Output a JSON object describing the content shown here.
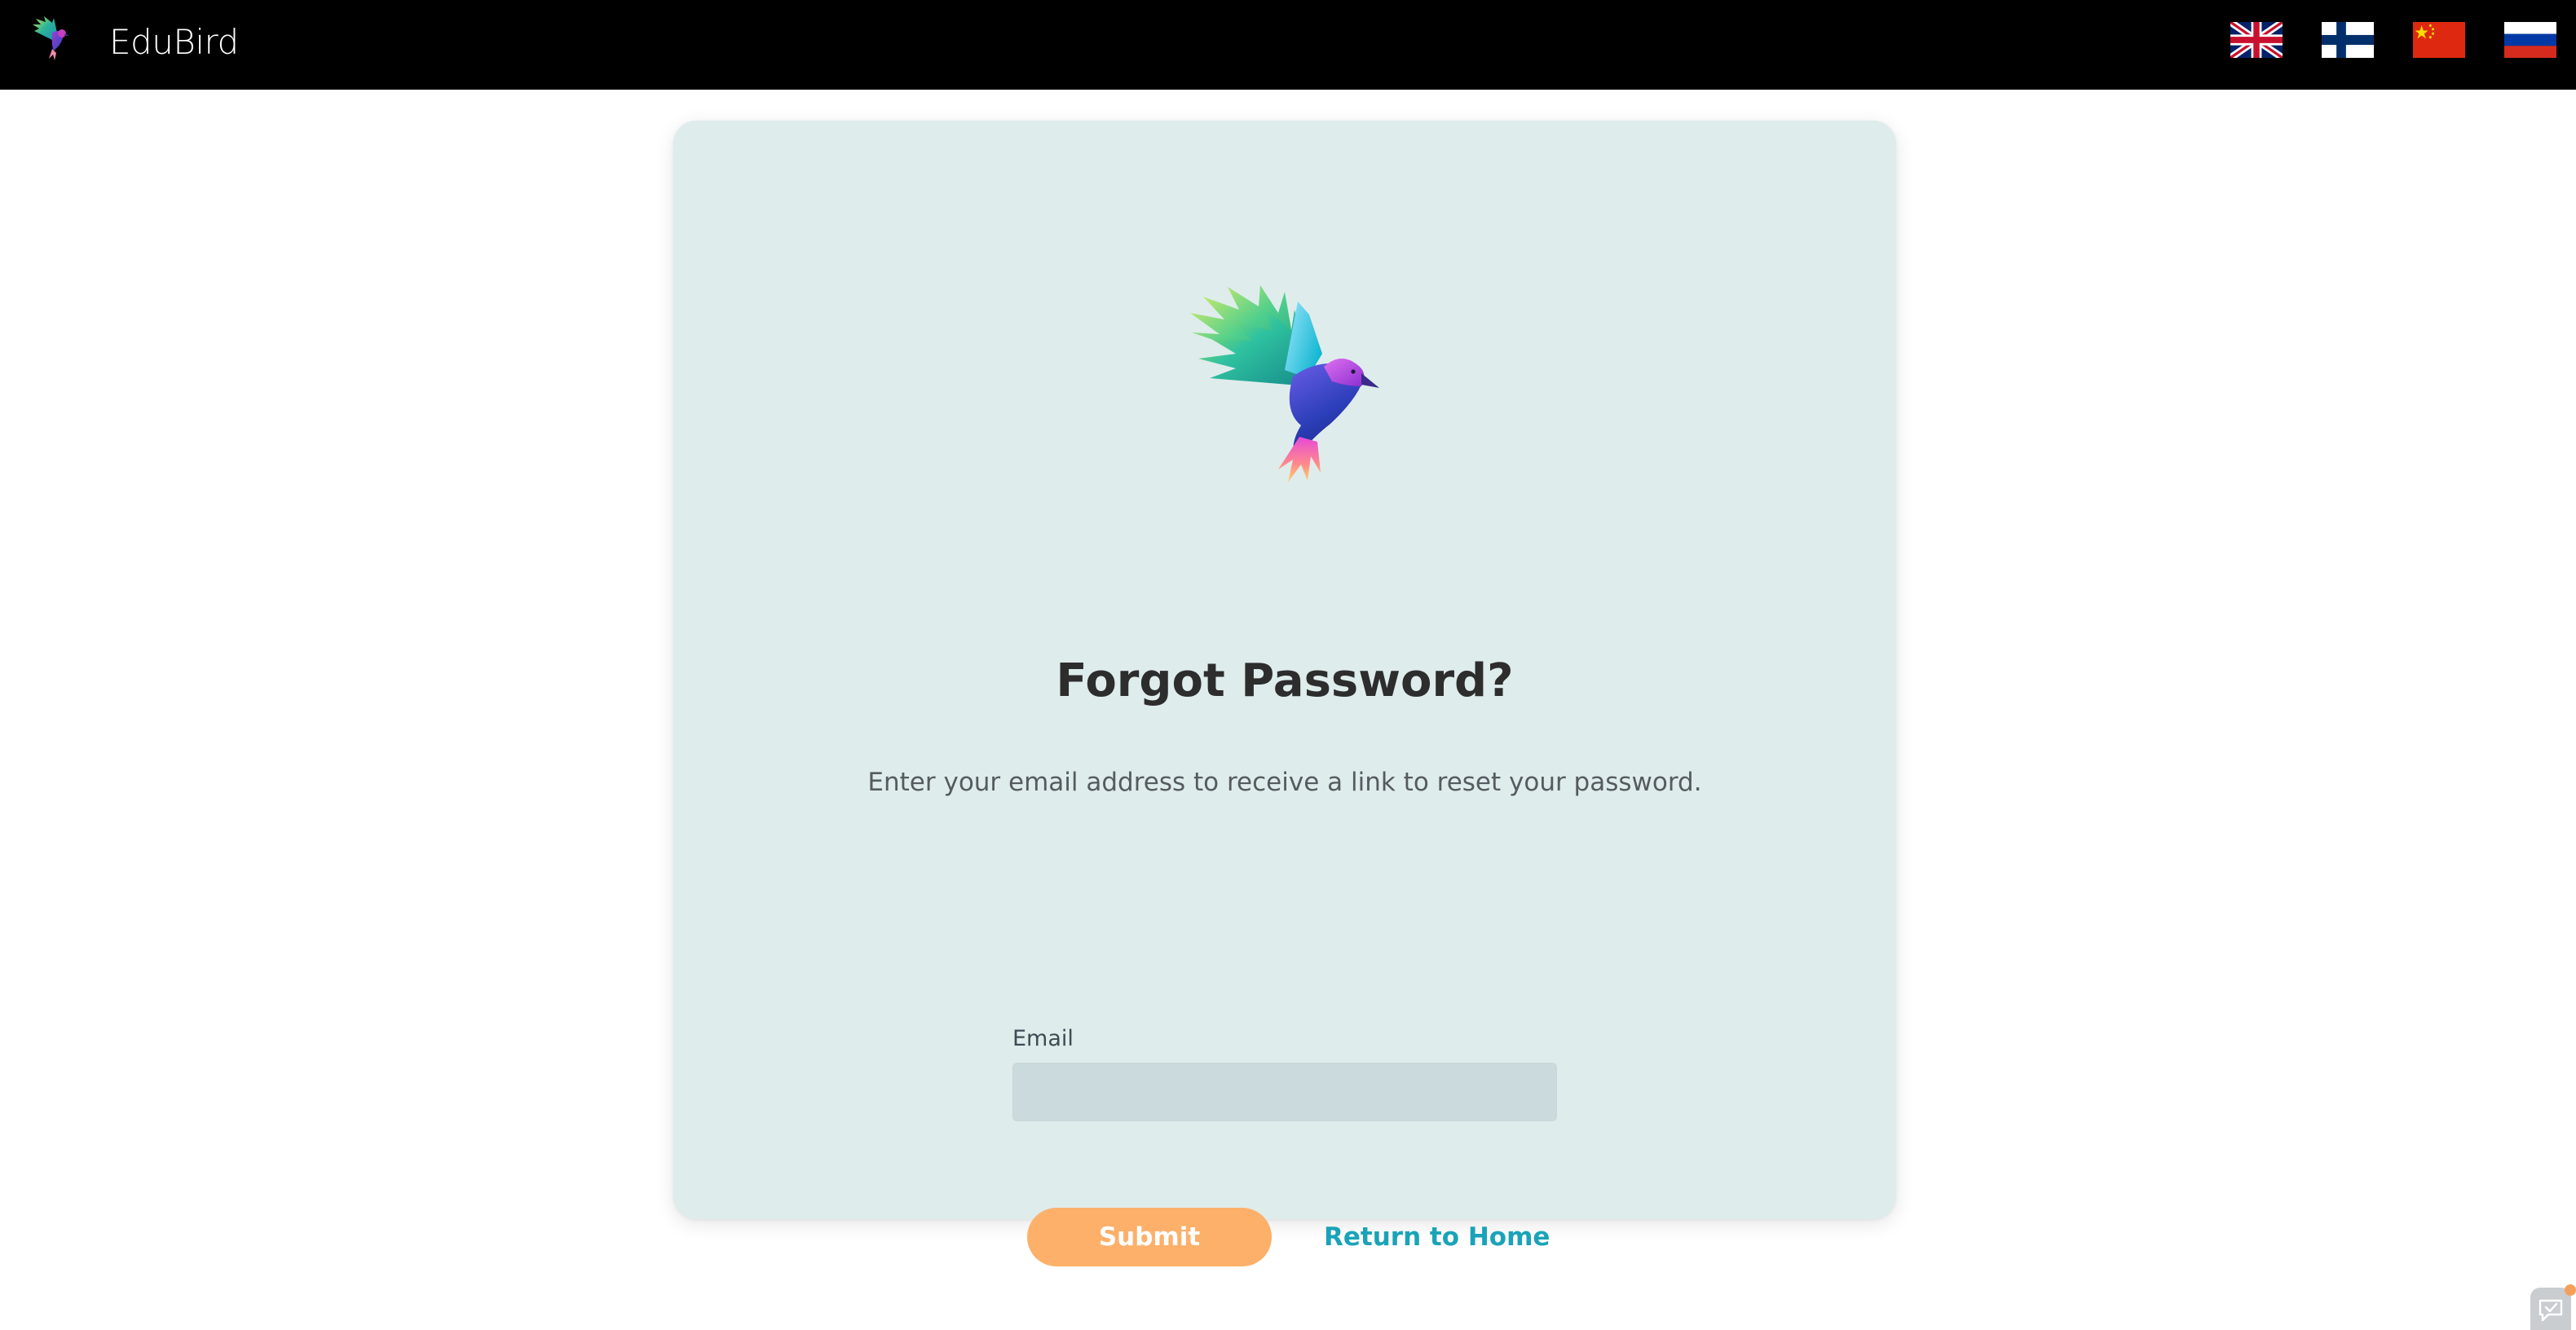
{
  "navbar": {
    "brand_name": "EduBird",
    "logo_icon": "bird-logo-icon",
    "languages": [
      {
        "code": "en",
        "icon": "uk-flag-icon"
      },
      {
        "code": "fi",
        "icon": "finland-flag-icon"
      },
      {
        "code": "zh",
        "icon": "china-flag-icon"
      },
      {
        "code": "ru",
        "icon": "russia-flag-icon"
      }
    ]
  },
  "form": {
    "title": "Forgot Password?",
    "subtitle": "Enter your email address to receive a link to reset your password.",
    "email_label": "Email",
    "email_value": "",
    "email_placeholder": "",
    "submit_label": "Submit",
    "home_link_label": "Return to Home"
  },
  "colors": {
    "navbar_bg": "#000000",
    "card_bg": "#dfecec",
    "input_bg": "#cbdadd",
    "submit_bg": "#fdb06a",
    "link": "#1aa3b8",
    "title": "#2d2d2d"
  }
}
